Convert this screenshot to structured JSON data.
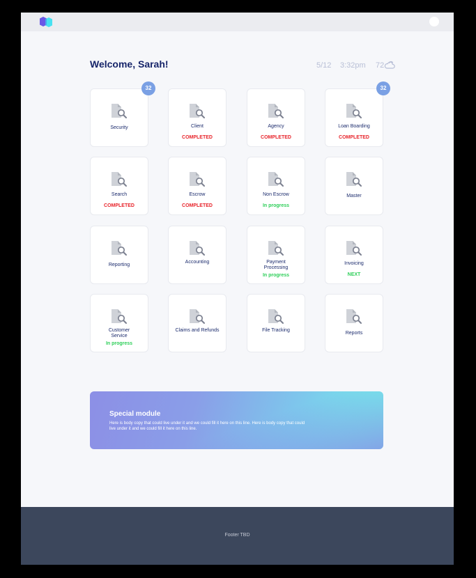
{
  "header": {
    "welcome": "Welcome, Sarah!",
    "date": "5/12",
    "time": "3:32pm",
    "temperature": "72",
    "weather_icon": "cloud-icon"
  },
  "tiles": [
    {
      "name": "Security",
      "status": "",
      "badge": "32"
    },
    {
      "name": "Client",
      "status": "COMPLETED",
      "badge": ""
    },
    {
      "name": "Agency",
      "status": "COMPLETED",
      "badge": ""
    },
    {
      "name": "Loan Boarding",
      "status": "COMPLETED",
      "badge": "32"
    },
    {
      "name": "Search",
      "status": "COMPLETED",
      "badge": ""
    },
    {
      "name": "Escrow",
      "status": "COMPLETED",
      "badge": ""
    },
    {
      "name": "Non Escrow",
      "status": "In progress",
      "badge": ""
    },
    {
      "name": "Master",
      "status": "",
      "badge": ""
    },
    {
      "name": "Reporting",
      "status": "",
      "badge": ""
    },
    {
      "name": "Accounting",
      "status": "",
      "badge": ""
    },
    {
      "name": "Payment Processing",
      "status": "In progress",
      "badge": ""
    },
    {
      "name": "Invoicing",
      "status": "NEXT",
      "badge": ""
    },
    {
      "name": "Customer Service",
      "status": "In progress",
      "badge": ""
    },
    {
      "name": "Claims and Refunds",
      "status": "",
      "badge": ""
    },
    {
      "name": "File Tracking",
      "status": "",
      "badge": ""
    },
    {
      "name": "Reports",
      "status": "",
      "badge": ""
    }
  ],
  "special_module": {
    "title": "Special module",
    "body": "Here is body copy that could live under it and we could fill it here on this line. Here is body copy that could live under it and we could fill it here on this line."
  },
  "footer": {
    "text": "Footer TBD"
  },
  "colors": {
    "completed": "#e8242b",
    "in_progress": "#2fcf5a",
    "badge": "#7aa0e4",
    "title": "#17256a",
    "footer_bg": "#3c475c"
  }
}
